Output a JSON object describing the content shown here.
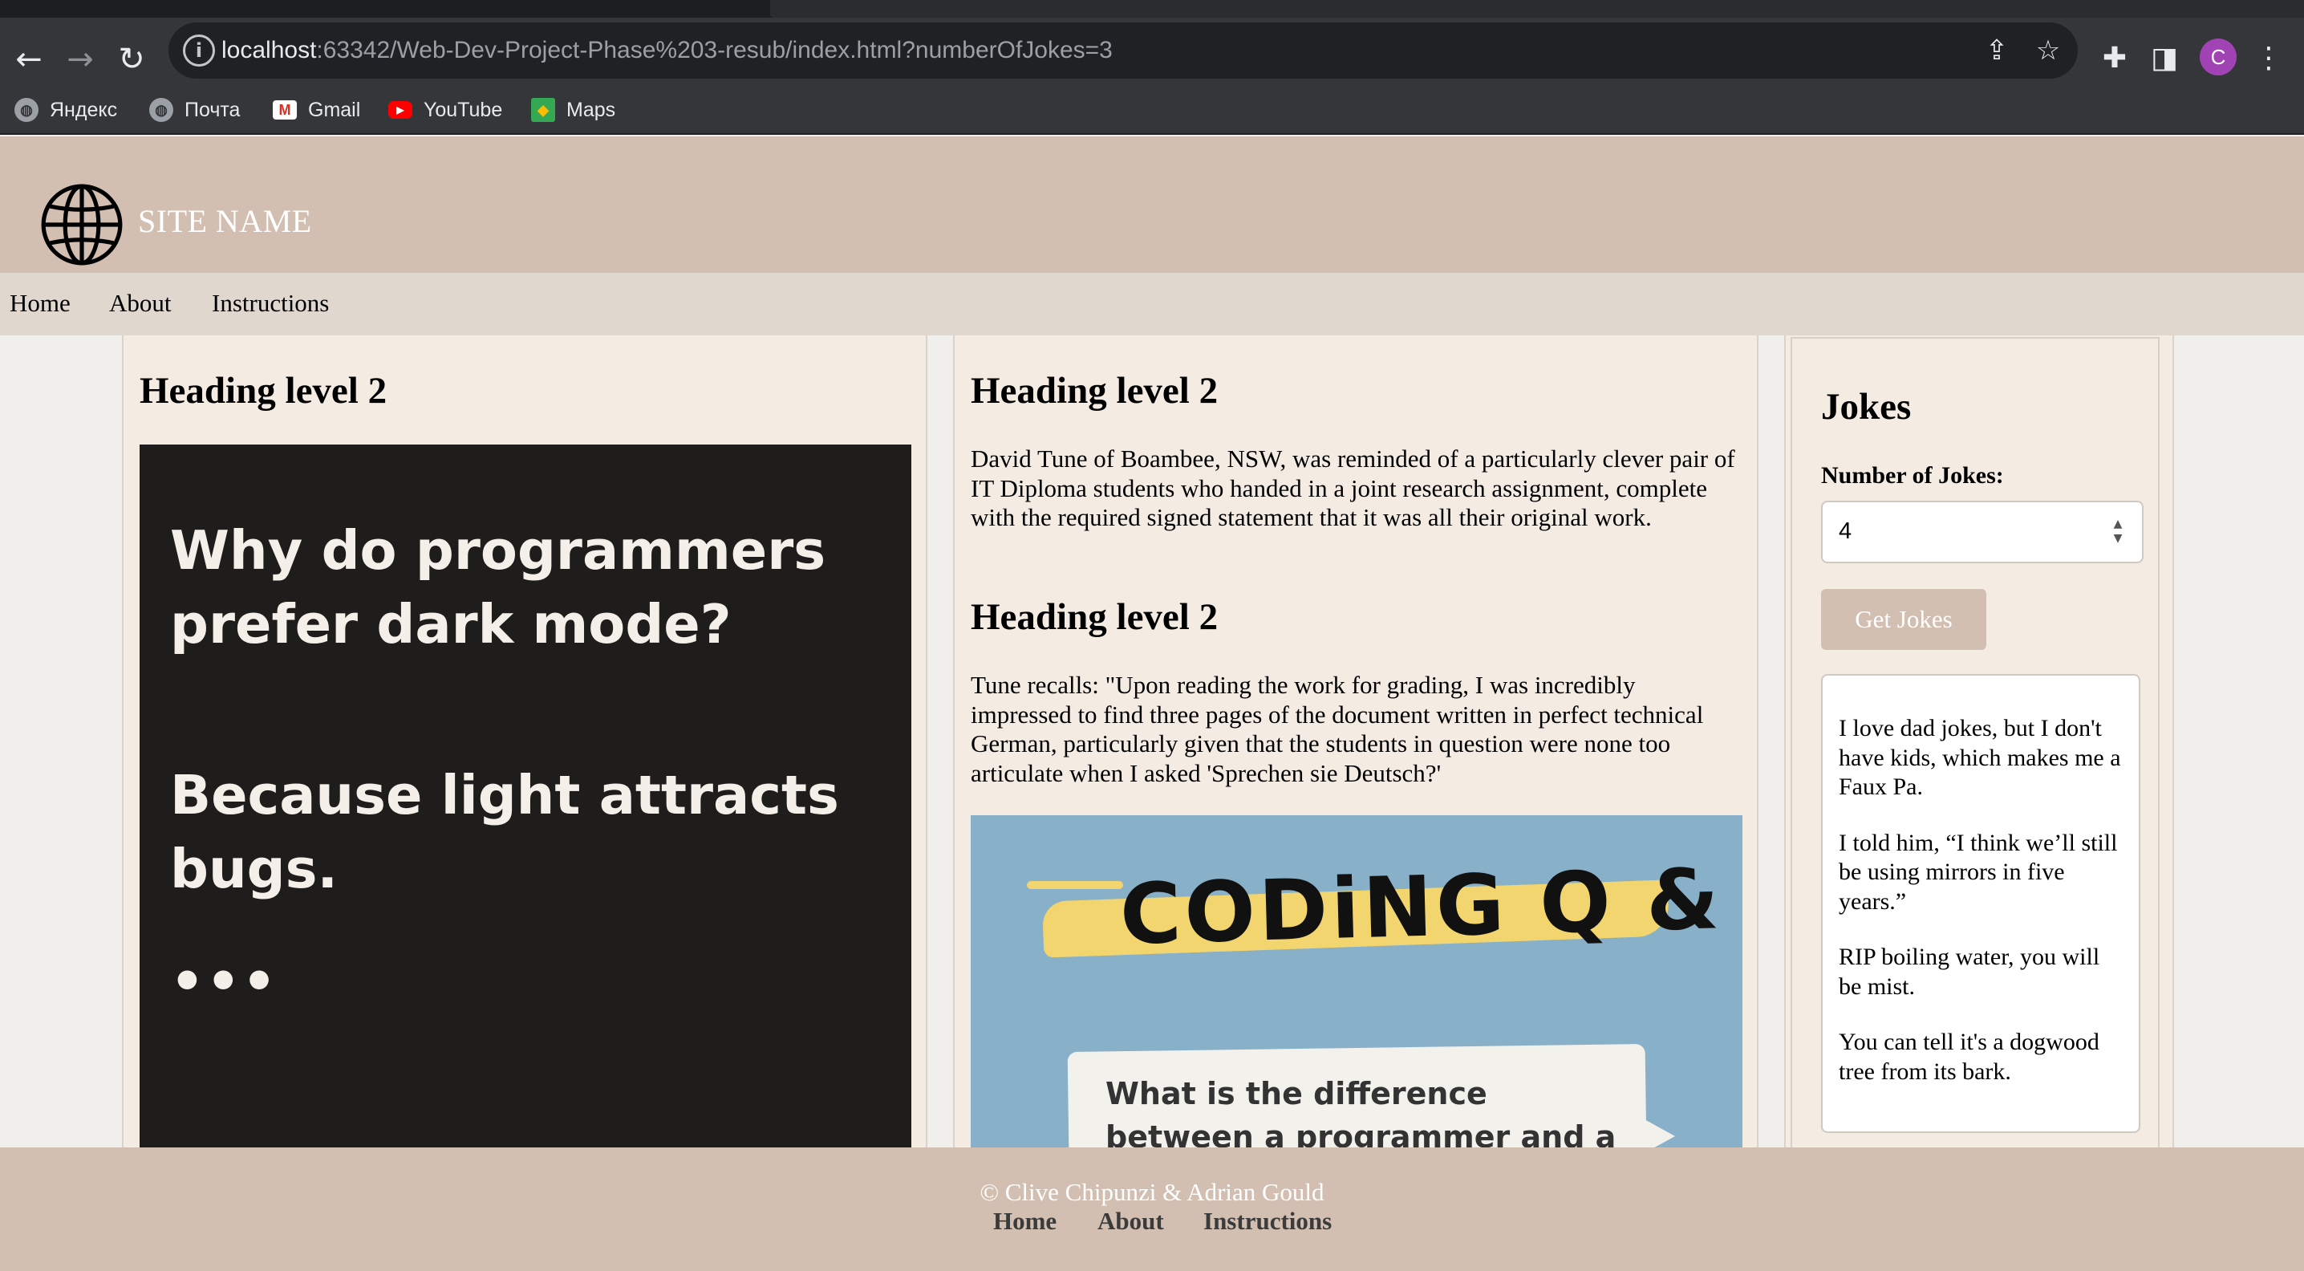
{
  "browser": {
    "url_host": "localhost",
    "url_rest": ":63342/Web-Dev-Project-Phase%203-resub/index.html?numberOfJokes=3",
    "icons": [
      "back-icon",
      "forward-icon",
      "reload-icon",
      "info-icon",
      "share-icon",
      "star-icon",
      "extensions-icon",
      "side-panel-icon",
      "menu-icon"
    ],
    "profile_initial": "C",
    "bookmarks": [
      {
        "label": "Яндекс",
        "icon": "globe-icon"
      },
      {
        "label": "Почта",
        "icon": "globe-icon"
      },
      {
        "label": "Gmail",
        "icon": "gmail-icon",
        "color": "#d93025"
      },
      {
        "label": "YouTube",
        "icon": "youtube-icon",
        "color": "#ff0000"
      },
      {
        "label": "Maps",
        "icon": "maps-icon",
        "color": "#34a853"
      }
    ]
  },
  "header": {
    "site_name": "SITE NAME",
    "logo_icon": "globe-icon"
  },
  "nav": [
    "Home",
    "About",
    "Instructions"
  ],
  "col1": {
    "heading": "Heading level 2",
    "meme": {
      "question": "Why do programmers prefer dark mode?",
      "answer": "Because light attracts bugs.",
      "ellipsis": "•••"
    }
  },
  "col2": {
    "heading1": "Heading level 2",
    "para1": "David Tune of Boambee, NSW, was reminded of a particularly clever pair of IT Diploma students who handed in a joint research assignment, complete with the required signed statement that it was all their original work.",
    "heading2": "Heading level 2",
    "para2": "Tune recalls: \"Upon reading the work for grading, I was incredibly impressed to find three pages of the document written in perfect technical German, particularly given that the students in question were none too articulate when I asked 'Sprechen sie Deutsch?'",
    "image": {
      "title": "CODiNG Q & A's",
      "bubble": "What is the difference between a programmer and a non-"
    }
  },
  "jokes_panel": {
    "title": "Jokes",
    "label": "Number of Jokes:",
    "input_value": "4",
    "button": "Get Jokes",
    "jokes": [
      "I love dad jokes, but I don't have kids, which makes me a Faux Pa.",
      "I told him, “I think we’ll still be using mirrors in five years.”",
      "RIP boiling water, you will be mist.",
      "You can tell it's a dogwood tree from its bark."
    ]
  },
  "footer": {
    "copyright": "© Clive Chipunzi & Adrian Gould",
    "nav": [
      "Home",
      "About",
      "Instructions"
    ]
  },
  "colors": {
    "header_bg": "#d3bfb1",
    "nav_bg": "#e0d7ce",
    "column_bg": "#f4ebe3",
    "meme_bg": "#1e1d1c",
    "qa_bg": "#88b0c8",
    "qa_brush": "#f2d56e"
  }
}
